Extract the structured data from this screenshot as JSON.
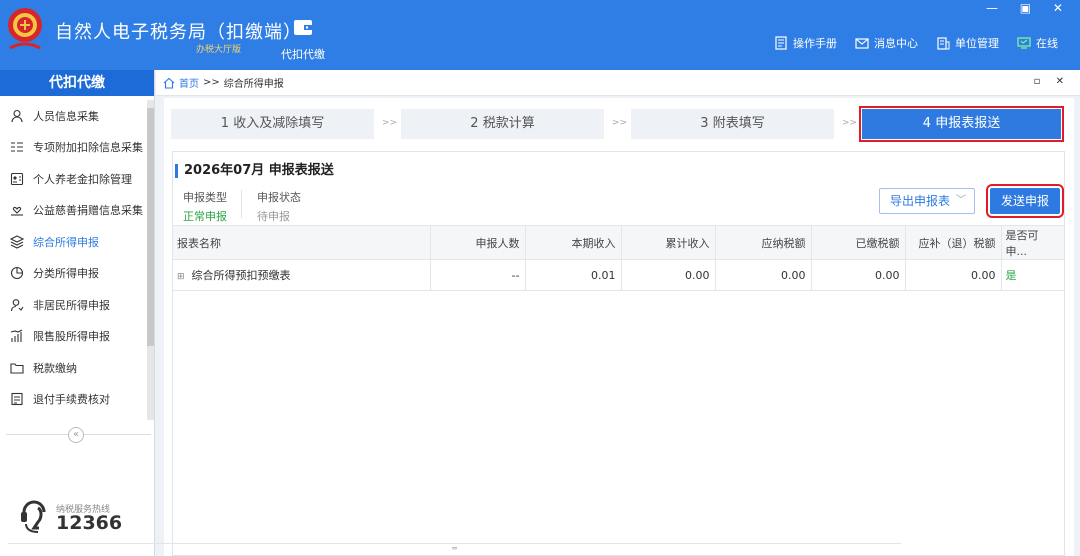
{
  "app": {
    "title": "自然人电子税务局（扣缴端）",
    "subtitle": "办税大厅版",
    "nav_daikou": "代扣代缴",
    "toolbar": [
      {
        "label": "操作手册",
        "icon": "manual-icon"
      },
      {
        "label": "消息中心",
        "icon": "mail-icon"
      },
      {
        "label": "单位管理",
        "icon": "building-icon"
      },
      {
        "label": "在线",
        "icon": "monitor-icon"
      }
    ],
    "window_controls": "— ▣ ✕"
  },
  "sidebar": {
    "header": "代扣代缴",
    "items": [
      {
        "label": "人员信息采集",
        "icon": "person-icon"
      },
      {
        "label": "专项附加扣除信息采集",
        "icon": "list-icon"
      },
      {
        "label": "个人养老金扣除管理",
        "icon": "id-card-icon"
      },
      {
        "label": "公益慈善捐赠信息采集",
        "icon": "donation-icon"
      },
      {
        "label": "综合所得申报",
        "icon": "layers-icon",
        "active": true
      },
      {
        "label": "分类所得申报",
        "icon": "pie-icon"
      },
      {
        "label": "非居民所得申报",
        "icon": "person-outline-icon"
      },
      {
        "label": "限售股所得申报",
        "icon": "bar-chart-icon"
      },
      {
        "label": "税款缴纳",
        "icon": "folder-icon"
      },
      {
        "label": "退付手续费核对",
        "icon": "document-icon"
      }
    ],
    "collapse": "«",
    "hotline_label": "纳税服务热线",
    "hotline_number": "12366"
  },
  "breadcrumb": {
    "home": "首页",
    "sep": ">>",
    "current": "综合所得申报",
    "window_controls": "▫ ✕"
  },
  "steps": [
    {
      "label": "1 收入及减除填写"
    },
    {
      "label": "2 税款计算"
    },
    {
      "label": "3 附表填写"
    },
    {
      "label": "4 申报表报送",
      "active": true
    }
  ],
  "step_arrow": ">>",
  "panel": {
    "title": "2026年07月  申报表报送",
    "type_label": "申报类型",
    "type_value": "正常申报",
    "status_label": "申报状态",
    "status_value": "待申报",
    "export_button": "导出申报表",
    "send_button": "发送申报"
  },
  "table": {
    "headers": [
      "报表名称",
      "申报人数",
      "本期收入",
      "累计收入",
      "应纳税额",
      "已缴税额",
      "应补（退）税额",
      "是否可申..."
    ],
    "rows": [
      [
        "综合所得预扣预缴表",
        "--",
        "0.01",
        "0.00",
        "0.00",
        "0.00",
        "0.00",
        "是"
      ]
    ]
  },
  "colors": {
    "primary": "#2e7ae0",
    "titlebar": "#2f7ee6",
    "highlight": "#e01b2a",
    "success": "#28a745",
    "subtitle_gold": "#f7d26b"
  }
}
